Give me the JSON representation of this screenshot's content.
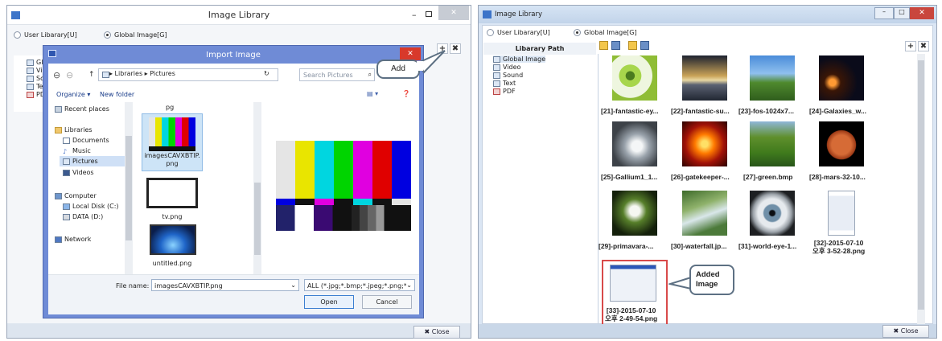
{
  "left": {
    "title": "Image Library",
    "radio_user": "User Libarary[U]",
    "radio_global": "Global Image[G]",
    "tree": [
      "Glob",
      "Vide",
      "Sou",
      "Text",
      "PDF"
    ],
    "close": "✖ Close",
    "dialog": {
      "title": "Import Image",
      "path": "▸ Libraries ▸ Pictures",
      "search_placeholder": "Search Pictures",
      "organize": "Organize ▾",
      "new_folder": "New folder",
      "nav": [
        "Recent places",
        "Libraries",
        "Documents",
        "Music",
        "Pictures",
        "Videos",
        "Computer",
        "Local Disk (C:)",
        "DATA (D:)",
        "Network"
      ],
      "top_label": "pg",
      "files": [
        "imagesCAVXBTIP.png",
        "tv.png",
        "untitled.png"
      ],
      "file_name_label": "File name:",
      "file_name_value": "imagesCAVXBTIP.png",
      "filter": "ALL (*.jpg;*.bmp;*.jpeg;*.png;*.",
      "open": "Open",
      "cancel": "Cancel"
    },
    "callout_add": "Add"
  },
  "right": {
    "title": "Image Library",
    "radio_user": "User Libarary[U]",
    "radio_global": "Global Image[G]",
    "tree_header": "Libarary Path",
    "tree": [
      "Global Image",
      "Video",
      "Sound",
      "Text",
      "PDF"
    ],
    "captions": [
      "[21]-fantastic-ey...",
      "[22]-fantastic-su...",
      "[23]-fos-1024x7...",
      "[24]-Galaxies_w...",
      "[25]-Gallium1_1...",
      "[26]-gatekeeper-...",
      "[27]-green.bmp",
      "[28]-mars-32-10...",
      "[29]-primavara-...",
      "[30]-waterfall.jp...",
      "[31]-world-eye-1...",
      "[32]-2015-07-10\n오후 3-52-28.png",
      "[33]-2015-07-10\n오후 2-49-54.png"
    ],
    "callout_added": "Added\nImage",
    "close": "✖ Close"
  }
}
